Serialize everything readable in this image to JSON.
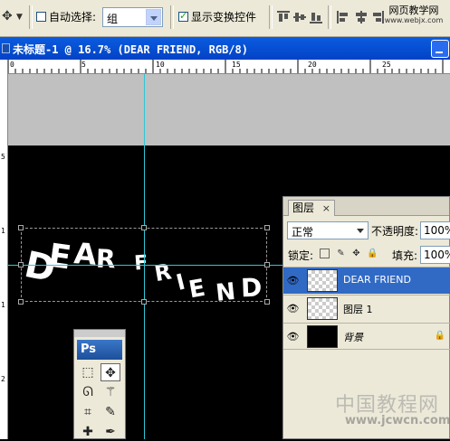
{
  "options_bar": {
    "move_tool_icon": "move-tool-icon",
    "auto_select_label": "自动选择:",
    "auto_select_checked": false,
    "auto_select_value": "组",
    "show_transform_label": "显示变换控件",
    "show_transform_checked": true,
    "brand_top": "网页教学网",
    "brand_bottom": "www.webjx.com"
  },
  "document": {
    "title": "未标题-1 @ 16.7% (DEAR FRIEND, RGB/8)",
    "zoom": "16.7%"
  },
  "ruler": {
    "h_labels": [
      "0",
      "5",
      "10",
      "15",
      "20",
      "25"
    ],
    "v_labels": [
      "5",
      "1",
      "1",
      "2"
    ]
  },
  "canvas_text": "DEAR FRIEND",
  "canvas_letters": [
    "D",
    "E",
    "A",
    "R",
    "F",
    "R",
    "I",
    "E",
    "N",
    "D"
  ],
  "tools_panel": {
    "logo": "Ps",
    "tools": [
      "marquee-tool",
      "move-tool",
      "lasso-tool",
      "magic-wand-tool",
      "crop-tool",
      "slice-tool",
      "healing-tool",
      "brush-tool"
    ]
  },
  "layers_panel": {
    "tab_label": "图层",
    "tab_close": "×",
    "blend_mode": "正常",
    "opacity_label": "不透明度:",
    "opacity_value": "100%",
    "lock_label": "锁定:",
    "fill_label": "填充:",
    "fill_value": "100%",
    "layers": [
      {
        "name": "DEAR FRIEND",
        "selected": true,
        "visible": true
      },
      {
        "name": "图层 1",
        "selected": false,
        "visible": true
      },
      {
        "name": "背景",
        "selected": false,
        "visible": true,
        "locked": true
      }
    ]
  },
  "watermark": {
    "cn": "中国教程网",
    "url": "www.jcwcn.com"
  }
}
